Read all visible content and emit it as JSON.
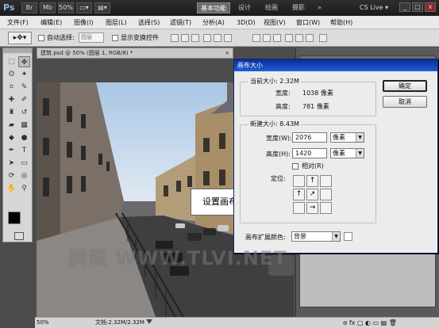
{
  "app": {
    "logo": "Ps",
    "title_buttons": [
      "Br",
      "Mb",
      "50%",
      "▭▾",
      "▤▾"
    ],
    "workspaces": [
      "基本功能",
      "设计",
      "绘画",
      "摄影",
      "»"
    ],
    "cs_live": "CS Live ▾",
    "window_controls": [
      "_",
      "□",
      "x"
    ]
  },
  "menu": [
    "文件(F)",
    "编辑(E)",
    "图像(I)",
    "图层(L)",
    "选择(S)",
    "滤镜(T)",
    "分析(A)",
    "3D(D)",
    "视图(V)",
    "窗口(W)",
    "帮助(H)"
  ],
  "options": {
    "auto_select_label": "自动选择:",
    "auto_select_value": "图层",
    "show_transform_label": "显示变换控件"
  },
  "document": {
    "tab_title": "建筑.psd @ 50% (图层 1, RGB/8) *",
    "close_glyph": "×",
    "zoom": "50%",
    "doc_info": "文档:2.32M/2.32M"
  },
  "dialog": {
    "title": "画布大小",
    "current_size_label": "当前大小: 2.32M",
    "current_width_label": "宽度:",
    "current_width_value": "1038 像素",
    "current_height_label": "高度:",
    "current_height_value": "781 像素",
    "new_size_label": "新建大小: 8.43M",
    "new_width_label": "宽度(W):",
    "new_width_value": "2076",
    "new_height_label": "高度(H):",
    "new_height_value": "1420",
    "unit": "像素",
    "relative_label": "相对(R)",
    "anchor_label": "定位:",
    "extension_color_label": "画布扩展颜色:",
    "extension_color_value": "背景",
    "ok_label": "确定",
    "cancel_label": "取消"
  },
  "callout": "设置画布大小参数",
  "watermark": "腾龍 WWW.TLVI.NET",
  "colors": {
    "accent_title": "#1e5fd6",
    "panel_bg": "#d6d6d6"
  }
}
